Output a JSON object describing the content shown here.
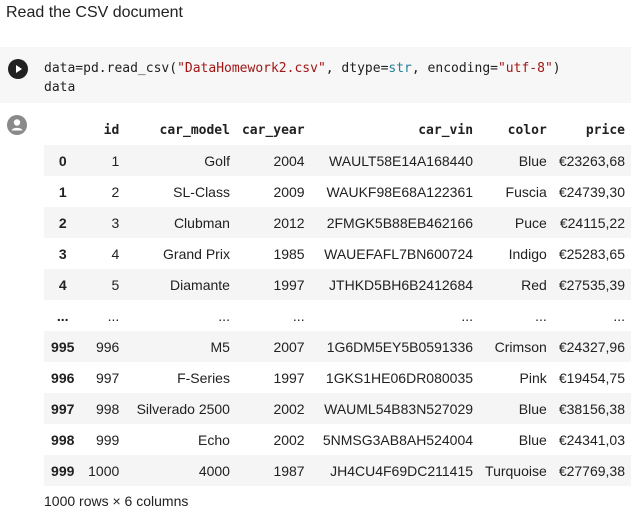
{
  "markdown_cell": {
    "text": "Read the CSV document"
  },
  "code_cell": {
    "line1_parts": [
      {
        "t": "data=pd.read_csv(",
        "c": ""
      },
      {
        "t": "\"DataHomework2.csv\"",
        "c": "tok-str"
      },
      {
        "t": ", dtype=",
        "c": ""
      },
      {
        "t": "str",
        "c": "tok-type"
      },
      {
        "t": ", encoding=",
        "c": ""
      },
      {
        "t": "\"utf-8\"",
        "c": "tok-str"
      },
      {
        "t": ")",
        "c": ""
      }
    ],
    "line2": "data",
    "run_icon": "play-icon",
    "output_icon": "output-icon"
  },
  "table": {
    "columns": [
      "",
      "id",
      "car_model",
      "car_year",
      "car_vin",
      "color",
      "price"
    ],
    "rows": [
      {
        "index": "0",
        "cells": [
          "1",
          "Golf",
          "2004",
          "WAULT58E14A168440",
          "Blue",
          "€23263,68"
        ]
      },
      {
        "index": "1",
        "cells": [
          "2",
          "SL-Class",
          "2009",
          "WAUKF98E68A122361",
          "Fuscia",
          "€24739,30"
        ]
      },
      {
        "index": "2",
        "cells": [
          "3",
          "Clubman",
          "2012",
          "2FMGK5B88EB462166",
          "Puce",
          "€24115,22"
        ]
      },
      {
        "index": "3",
        "cells": [
          "4",
          "Grand Prix",
          "1985",
          "WAUEFAFL7BN600724",
          "Indigo",
          "€25283,65"
        ]
      },
      {
        "index": "4",
        "cells": [
          "5",
          "Diamante",
          "1997",
          "JTHKD5BH6B2412684",
          "Red",
          "€27535,39"
        ]
      },
      {
        "index": "...",
        "cells": [
          "...",
          "...",
          "...",
          "...",
          "...",
          "..."
        ]
      },
      {
        "index": "995",
        "cells": [
          "996",
          "M5",
          "2007",
          "1G6DM5EY5B0591336",
          "Crimson",
          "€24327,96"
        ]
      },
      {
        "index": "996",
        "cells": [
          "997",
          "F-Series",
          "1997",
          "1GKS1HE06DR080035",
          "Pink",
          "€19454,75"
        ]
      },
      {
        "index": "997",
        "cells": [
          "998",
          "Silverado 2500",
          "2002",
          "WAUML54B83N527029",
          "Blue",
          "€38156,38"
        ]
      },
      {
        "index": "998",
        "cells": [
          "999",
          "Echo",
          "2002",
          "5NMSG3AB8AH524004",
          "Blue",
          "€24341,03"
        ]
      },
      {
        "index": "999",
        "cells": [
          "1000",
          "4000",
          "1987",
          "JH4CU4F69DC211415",
          "Turquoise",
          "€27769,38"
        ]
      }
    ]
  },
  "footer": {
    "shape_text": "1000 rows × 6 columns"
  },
  "colors": {
    "cell_bg": "#f7f7f7",
    "row_stripe": "#f5f5f5",
    "string_token": "#a31515",
    "type_token": "#267f99"
  }
}
